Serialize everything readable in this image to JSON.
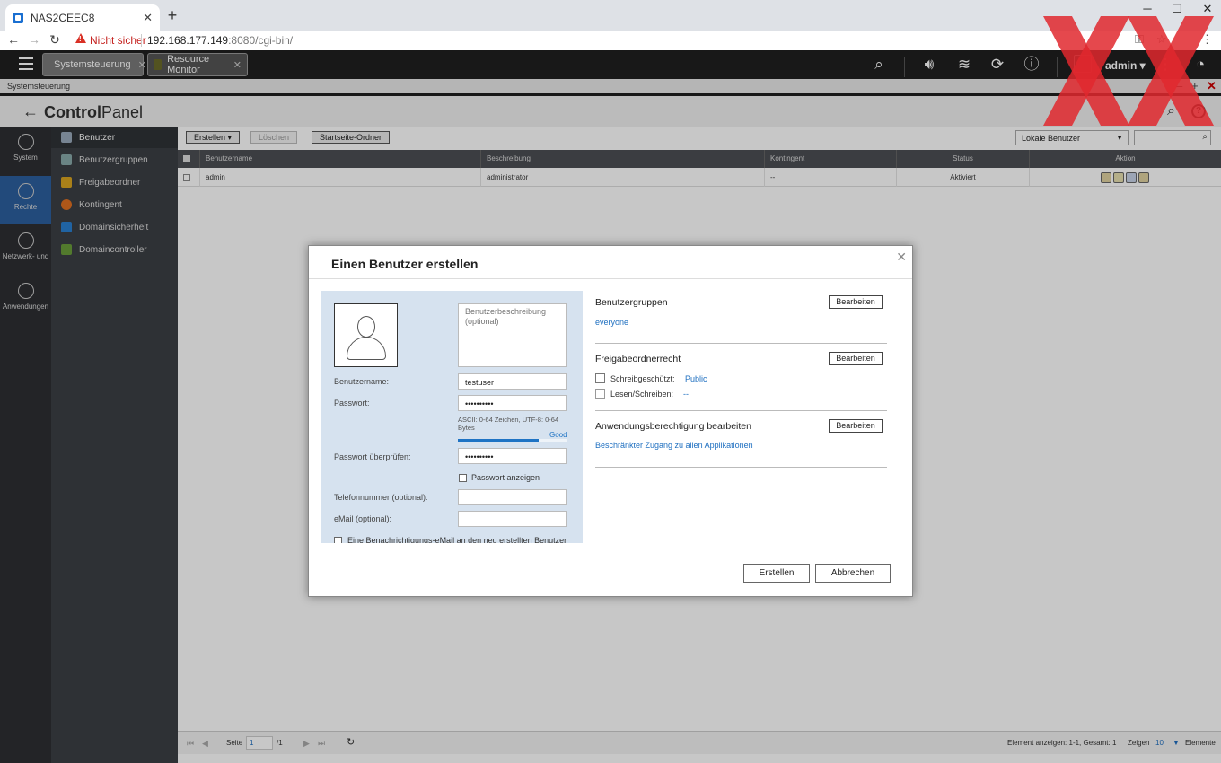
{
  "browser": {
    "tab_title": "NAS2CEEC8",
    "tab_close": "✕",
    "new_tab": "+",
    "insecure_label": "Nicht sicher",
    "url_host": "192.168.177.149",
    "url_rest": ":8080/cgi-bin/"
  },
  "nas_bar": {
    "tabs": [
      {
        "label": "Systemsteuerung",
        "close": "✕"
      },
      {
        "label": "Resource Monitor",
        "close": "✕"
      }
    ],
    "user": "admin ▾"
  },
  "app_bar": {
    "title": "Systemsteuerung"
  },
  "control_panel": {
    "title_a": "Control",
    "title_b": "Panel",
    "help": "?",
    "rail": [
      {
        "label": "System"
      },
      {
        "label": "Rechte",
        "active": true
      },
      {
        "label": "Netzwerk- und"
      },
      {
        "label": "Anwendungen"
      }
    ],
    "subnav": [
      {
        "label": "Benutzer",
        "active": true
      },
      {
        "label": "Benutzergruppen"
      },
      {
        "label": "Freigabeordner"
      },
      {
        "label": "Kontingent"
      },
      {
        "label": "Domainsicherheit"
      },
      {
        "label": "Domaincontroller"
      }
    ],
    "toolbar": {
      "create": "Erstellen ▾",
      "delete": "Löschen",
      "home_folder": "Startseite-Ordner",
      "filter": "Lokale Benutzer"
    },
    "table": {
      "headers": [
        "Benutzername",
        "Beschreibung",
        "Kontingent",
        "Status",
        "Aktion"
      ],
      "rows": [
        {
          "name": "admin",
          "description": "administrator",
          "quota": "--",
          "status": "Aktiviert"
        }
      ]
    },
    "pager": {
      "page_label": "Seite",
      "page": "1",
      "of": "/1",
      "summary": "Element anzeigen: 1-1, Gesamt: 1",
      "show_label": "Zeigen",
      "show_value": "10",
      "items_label": "Elemente"
    }
  },
  "dialog": {
    "title": "Einen Benutzer erstellen",
    "close": "✕",
    "description_placeholder": "Benutzerbeschreibung (optional)",
    "username_label": "Benutzername:",
    "username_value": "testuser",
    "password_label": "Passwort:",
    "password_value": "••••••••••",
    "password_hint": "ASCII: 0-64 Zeichen, UTF-8: 0-64 Bytes",
    "strength_label": "Good",
    "strength_fraction": 0.74,
    "verify_label": "Passwort überprüfen:",
    "verify_value": "••••••••••",
    "show_password": "Passwort anzeigen",
    "phone_label": "Telefonnummer (optional):",
    "email_label": "eMail (optional):",
    "notify_label": "Eine Benachrichtigungs-eMail an den neu erstellten Benutzer",
    "groups_title": "Benutzergruppen",
    "groups_value": "everyone",
    "share_title": "Freigabeordnerrecht",
    "readonly_label": "Schreibgeschützt:",
    "readonly_value": "Public",
    "readwrite_label": "Lesen/Schreiben:",
    "readwrite_value": "--",
    "app_title": "Anwendungsberechtigung bearbeiten",
    "app_value": "Beschränkter Zugang zu allen Applikationen",
    "edit_label": "Bearbeiten",
    "create_button": "Erstellen",
    "cancel_button": "Abbrechen"
  },
  "colors": {
    "accent": "#1e73c4",
    "rail_active": "#2c5f9e",
    "watermark": "#e0282e"
  }
}
